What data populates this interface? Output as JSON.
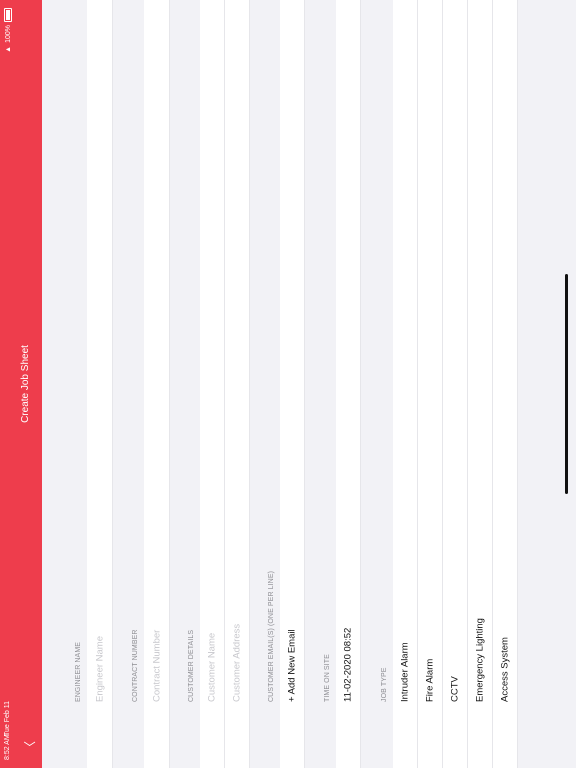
{
  "status": {
    "time": "8:52 AM",
    "date": "Tue Feb 11",
    "battery": "100%"
  },
  "nav": {
    "title": "Create Job Sheet",
    "back_icon": "chevron-down-icon"
  },
  "sections": {
    "engineer": {
      "label": "ENGINEER NAME",
      "placeholder": "Engineer Name"
    },
    "contract": {
      "label": "CONTRACT NUMBER",
      "placeholder": "Contract Number"
    },
    "customer": {
      "label": "CUSTOMER DETAILS",
      "name_placeholder": "Customer Name",
      "address_placeholder": "Customer Address"
    },
    "emails": {
      "label": "CUSTOMER EMAIL(S) (ONE PER LINE)",
      "add_label": "+ Add New Email"
    },
    "time_on_site": {
      "label": "TIME ON SITE",
      "value": "11-02-2020  08:52"
    },
    "job_type": {
      "label": "JOB TYPE",
      "options": [
        "Intruder Alarm",
        "Fire Alarm",
        "CCTV",
        "Emergency Lighting",
        "Access System"
      ]
    }
  },
  "colors": {
    "header": "#ee3d4c",
    "background": "#f2f2f6"
  }
}
